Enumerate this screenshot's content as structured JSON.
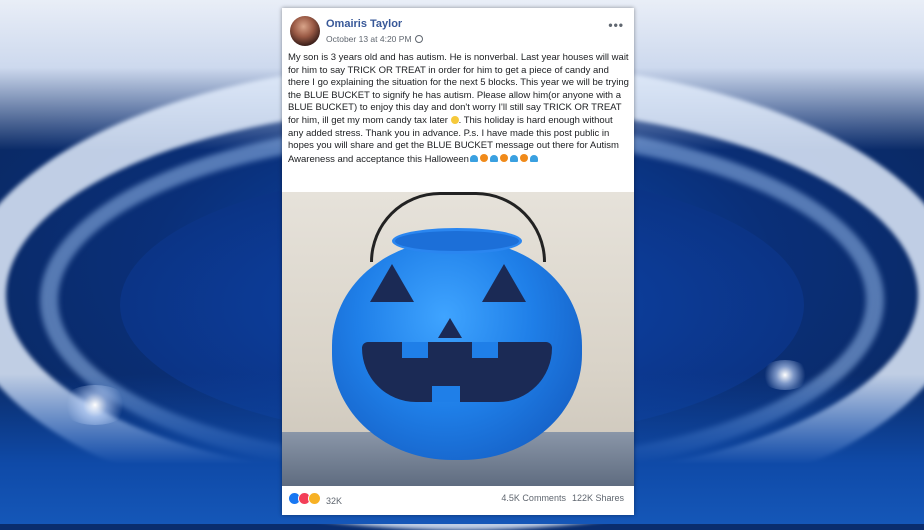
{
  "post": {
    "author": "Omairis Taylor",
    "timestamp": "October 13 at 4:20 PM",
    "privacy_icon": "globe-icon",
    "menu_icon": "more-dots-icon",
    "text": "My son is 3 years old and has autism. He is nonverbal. Last year houses will wait for him to say TRICK OR TREAT in order for him to get a piece of candy and there I go explaining the situation for the next 5 blocks. This year we will be trying the BLUE BUCKET to signify he has autism. Please allow him(or anyone with a BLUE BUCKET) to enjoy this day and don't worry I'll still say TRICK OR TREAT for him, ill get my mom candy tax later",
    "text_cont": ". This holiday is hard enough without any added stress. Thank you in advance. P.s. I have made this post public in hopes you will share and get the BLUE BUCKET message out there for Autism Awareness and acceptance this Halloween",
    "reaction_count": "32K",
    "comments": "4.5K Comments",
    "shares": "122K Shares"
  }
}
